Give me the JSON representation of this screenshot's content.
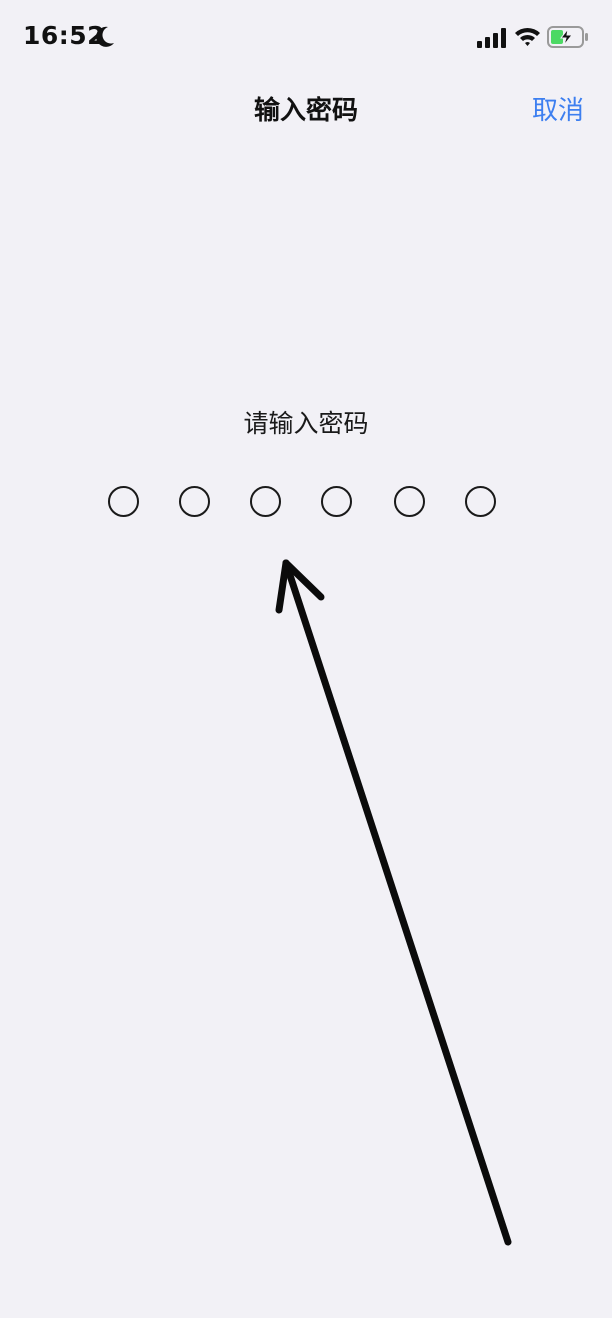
{
  "status_bar": {
    "time": "16:52",
    "icons": [
      "moon-icon",
      "signal-icon",
      "wifi-icon",
      "battery-icon"
    ],
    "battery_color": "#4cd964"
  },
  "nav": {
    "title": "输入密码",
    "cancel_label": "取消",
    "accent_color": "#3d7ff0"
  },
  "passcode": {
    "prompt": "请输入密码",
    "length": 6,
    "entered": 0
  },
  "annotation": {
    "icon": "arrow-icon",
    "points_to": "passcode-dots"
  }
}
